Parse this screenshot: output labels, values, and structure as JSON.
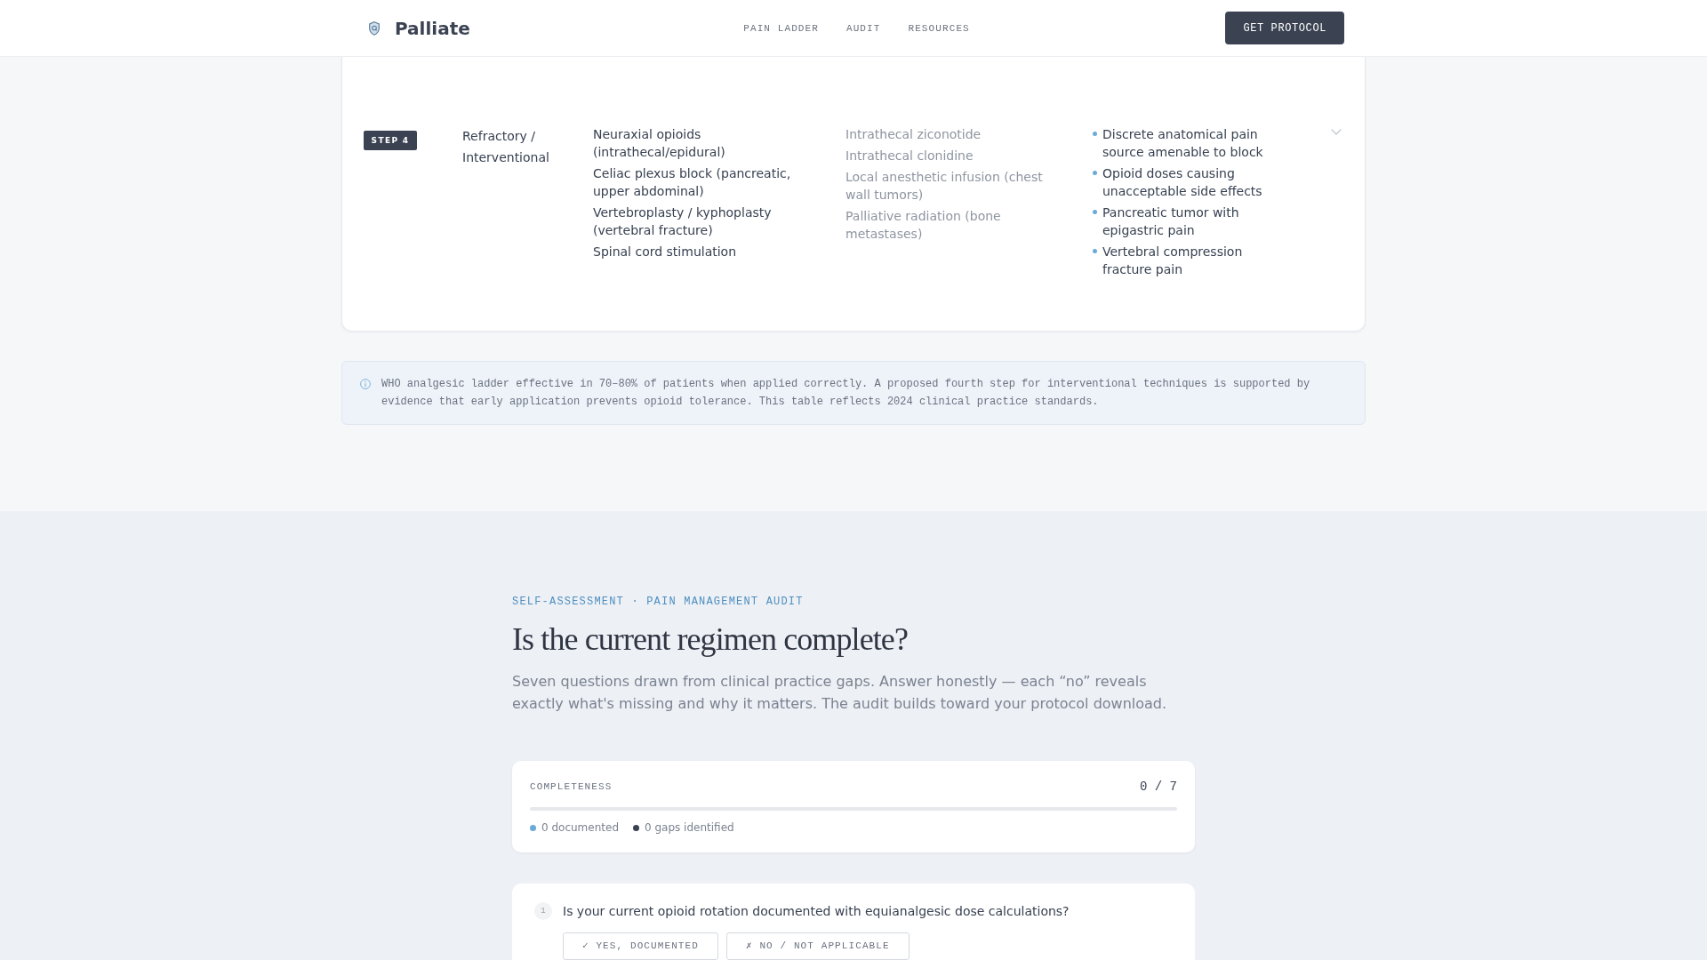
{
  "header": {
    "brand": "Palliate",
    "nav": [
      {
        "label": "PAIN LADDER"
      },
      {
        "label": "AUDIT"
      },
      {
        "label": "RESOURCES"
      }
    ],
    "button": "GET PROTOCOL"
  },
  "ladder": {
    "rows": [
      {
        "badge": "STEP 4",
        "column_2": "Refractory / Interventional",
        "column_3": [
          "Neuraxial opioids (intrathecal/epidural)",
          "Celiac plexus block (pancreatic, upper abdominal)",
          "Vertebroplasty / kyphoplasty (vertebral fracture)",
          "Spinal cord stimulation"
        ],
        "column_4": [
          "Intrathecal ziconotide",
          "Intrathecal clonidine",
          "Local anesthetic infusion (chest wall tumors)",
          "Palliative radiation (bone metastases)"
        ],
        "column_5": [
          "Discrete anatomical pain source amenable to block",
          "Opioid doses causing unacceptable side effects",
          "Pancreatic tumor with epigastric pain",
          "Vertebral compression fracture pain"
        ]
      }
    ]
  },
  "note": "WHO analgesic ladder effective in 70–80% of patients when applied correctly. A proposed fourth step for interventional techniques is supported by evidence that early application prevents opioid tolerance. This table reflects 2024 clinical practice standards.",
  "audit": {
    "eyebrow": "SELF-ASSESSMENT · PAIN MANAGEMENT AUDIT",
    "title": "Is the current regimen complete?",
    "intro": "Seven questions drawn from clinical practice gaps. Answer honestly — each “no” reveals exactly what's missing and why it matters. The audit builds toward your protocol download.",
    "progress": {
      "label": "COMPLETENESS",
      "count": "0 / 7",
      "level": 0,
      "legend": [
        {
          "label": "0 documented",
          "color": "#6aaad8"
        },
        {
          "label": "0 gaps identified",
          "color": "#3b4252"
        }
      ]
    },
    "questions": [
      {
        "number": "1",
        "text": "Is your current opioid rotation documented with equianalgesic dose calculations?",
        "options": [
          {
            "label": "✓ YES, DOCUMENTED",
            "selected": false
          },
          {
            "label": "✗ NO / NOT APPLICABLE",
            "selected": false
          }
        ]
      }
    ]
  }
}
